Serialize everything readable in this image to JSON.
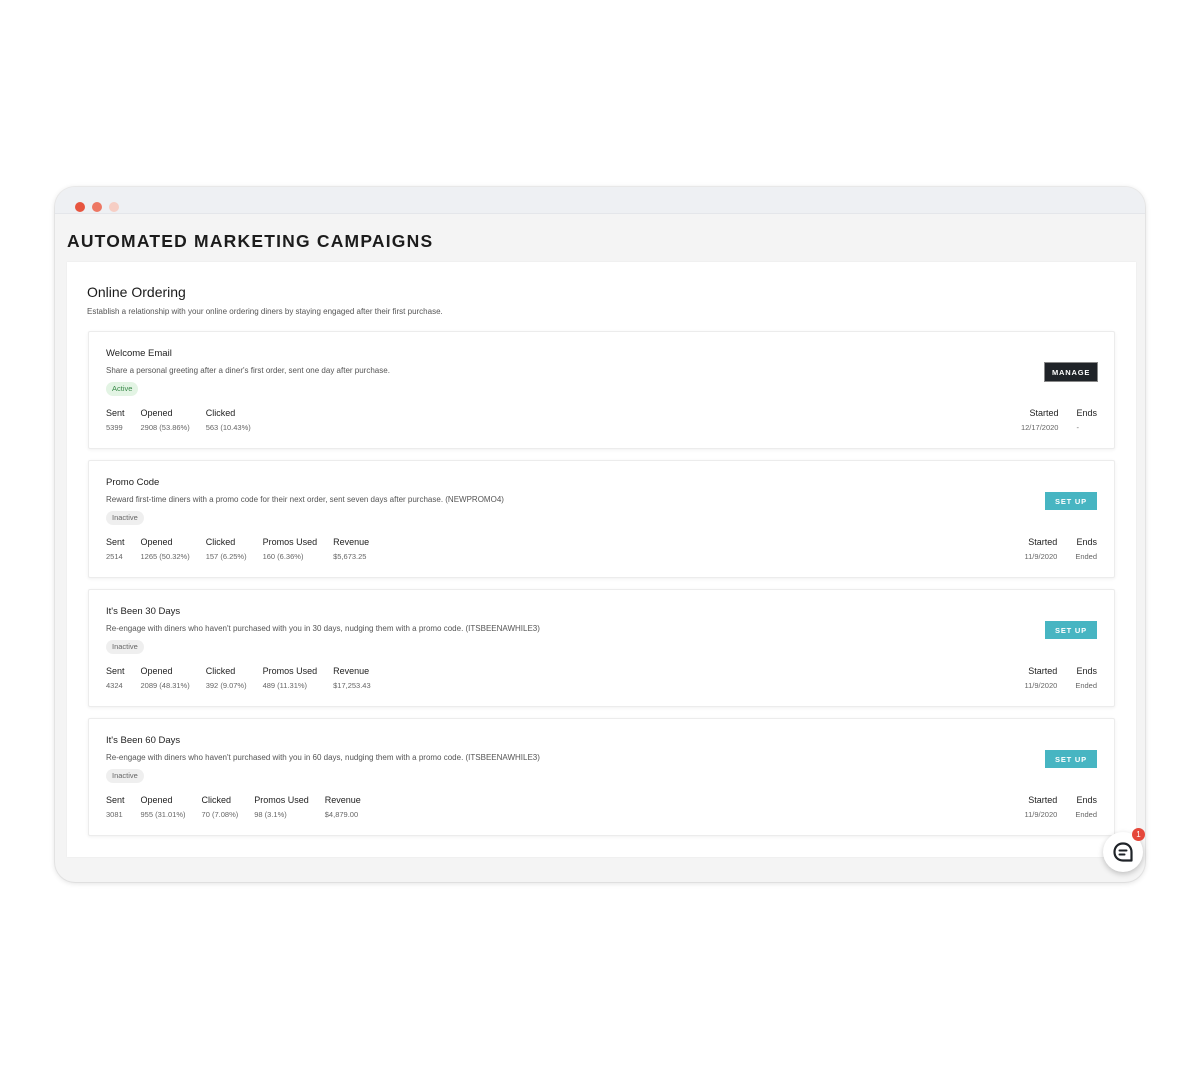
{
  "page": {
    "title": "AUTOMATED MARKETING CAMPAIGNS"
  },
  "section": {
    "title": "Online Ordering",
    "description": "Establish a relationship with your online ordering diners by staying engaged after their first purchase."
  },
  "campaigns": [
    {
      "title": "Welcome Email",
      "description": "Share a personal greeting after a diner's first order, sent one day after purchase.",
      "status": "Active",
      "button": "MANAGE",
      "stats": [
        {
          "label": "Sent",
          "value": "5399"
        },
        {
          "label": "Opened",
          "value": "2908 (53.86%)"
        },
        {
          "label": "Clicked",
          "value": "563 (10.43%)"
        }
      ],
      "started_label": "Started",
      "started": "12/17/2020",
      "ends_label": "Ends",
      "ends": "-"
    },
    {
      "title": "Promo Code",
      "description": "Reward first-time diners with a promo code for their next order, sent seven days after purchase. (NEWPROMO4)",
      "status": "Inactive",
      "button": "SET UP",
      "stats": [
        {
          "label": "Sent",
          "value": "2514"
        },
        {
          "label": "Opened",
          "value": "1265 (50.32%)"
        },
        {
          "label": "Clicked",
          "value": "157 (6.25%)"
        },
        {
          "label": "Promos Used",
          "value": "160 (6.36%)"
        },
        {
          "label": "Revenue",
          "value": "$5,673.25"
        }
      ],
      "started_label": "Started",
      "started": "11/9/2020",
      "ends_label": "Ends",
      "ends": "Ended"
    },
    {
      "title": "It's Been 30 Days",
      "description": "Re-engage with diners who haven't purchased with you in 30 days, nudging them with a promo code. (ITSBEENAWHILE3)",
      "status": "Inactive",
      "button": "SET UP",
      "stats": [
        {
          "label": "Sent",
          "value": "4324"
        },
        {
          "label": "Opened",
          "value": "2089 (48.31%)"
        },
        {
          "label": "Clicked",
          "value": "392 (9.07%)"
        },
        {
          "label": "Promos Used",
          "value": "489 (11.31%)"
        },
        {
          "label": "Revenue",
          "value": "$17,253.43"
        }
      ],
      "started_label": "Started",
      "started": "11/9/2020",
      "ends_label": "Ends",
      "ends": "Ended"
    },
    {
      "title": "It's Been 60 Days",
      "description": "Re-engage with diners who haven't purchased with you in 60 days, nudging them with a promo code. (ITSBEENAWHILE3)",
      "status": "Inactive",
      "button": "SET UP",
      "stats": [
        {
          "label": "Sent",
          "value": "3081"
        },
        {
          "label": "Opened",
          "value": "955 (31.01%)"
        },
        {
          "label": "Clicked",
          "value": "70 (7.08%)"
        },
        {
          "label": "Promos Used",
          "value": "98 (3.1%)"
        },
        {
          "label": "Revenue",
          "value": "$4,879.00"
        }
      ],
      "started_label": "Started",
      "started": "11/9/2020",
      "ends_label": "Ends",
      "ends": "Ended"
    }
  ],
  "chat": {
    "badge_count": "1",
    "icon": "chat-icon"
  },
  "colors": {
    "setup_button": "#47b5c2",
    "manage_button": "#1f2328",
    "active_badge": "#e3f4e4",
    "notification": "#e5483b"
  }
}
